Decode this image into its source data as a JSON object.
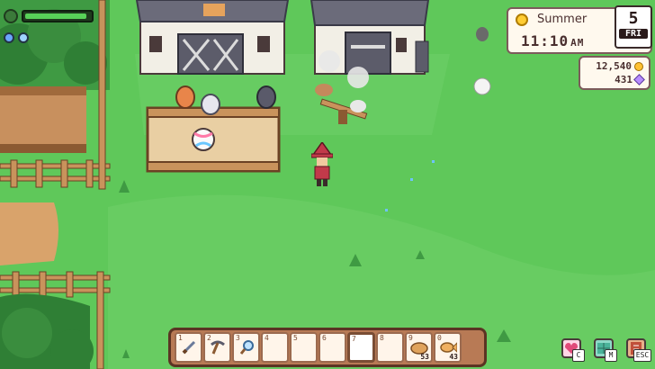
{
  "hud": {
    "energy_level": 0.95,
    "colors": {
      "energy": "#58d158",
      "grass": "#5fc85a",
      "wood": "#b87a55"
    }
  },
  "clock": {
    "season": "Summer",
    "time": "11:10",
    "ampm": "AM",
    "day_number": "5",
    "day_name": "FRI"
  },
  "currency": {
    "gold": "12,540",
    "essence": "431"
  },
  "hotbar": {
    "slots": [
      {
        "key": "1",
        "item": "sword-icon",
        "count": ""
      },
      {
        "key": "2",
        "item": "pickaxe-icon",
        "count": ""
      },
      {
        "key": "3",
        "item": "net-icon",
        "count": ""
      },
      {
        "key": "4",
        "item": "",
        "count": ""
      },
      {
        "key": "5",
        "item": "",
        "count": ""
      },
      {
        "key": "6",
        "item": "",
        "count": ""
      },
      {
        "key": "7",
        "item": "",
        "count": ""
      },
      {
        "key": "8",
        "item": "",
        "count": ""
      },
      {
        "key": "9",
        "item": "bread-icon",
        "count": "53"
      },
      {
        "key": "0",
        "item": "fish-icon",
        "count": "43"
      }
    ],
    "selected_slot": "7"
  },
  "menu": {
    "character_key": "C",
    "map_key": "M",
    "journal_key": "ESC"
  }
}
